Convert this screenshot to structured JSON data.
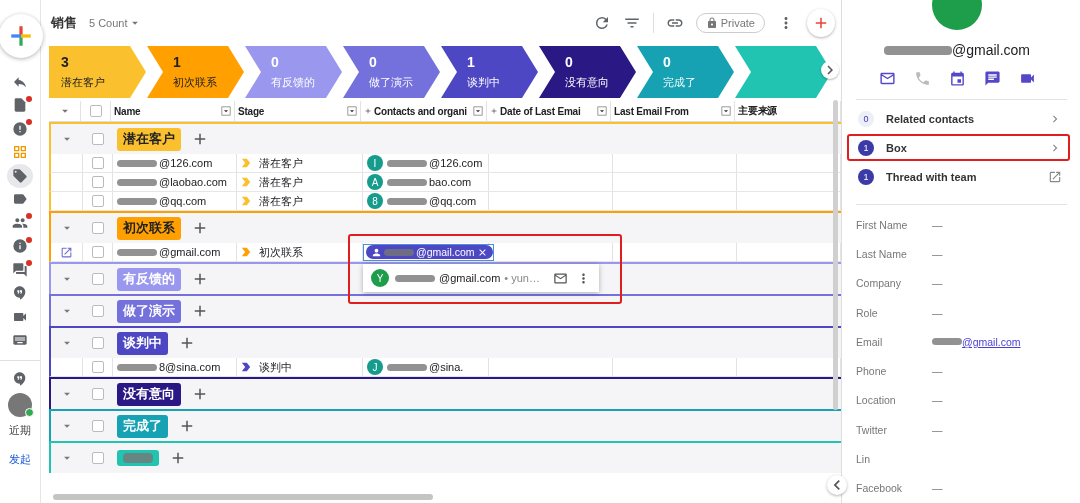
{
  "header": {
    "title": "销售",
    "count": "5 Count",
    "visibility": "Private"
  },
  "sidebar": {
    "items": [
      {
        "kind": "reply",
        "dot": false,
        "selected": false,
        "accent": false
      },
      {
        "kind": "doc",
        "dot": true,
        "selected": false,
        "accent": false
      },
      {
        "kind": "alert",
        "dot": true,
        "selected": false,
        "accent": false
      },
      {
        "kind": "grid",
        "dot": false,
        "selected": false,
        "accent": true
      },
      {
        "kind": "tag",
        "dot": false,
        "selected": true,
        "accent": false
      },
      {
        "kind": "label",
        "dot": false,
        "selected": false,
        "accent": false
      },
      {
        "kind": "people",
        "dot": true,
        "selected": false,
        "accent": false
      },
      {
        "kind": "info",
        "dot": true,
        "selected": false,
        "accent": false
      },
      {
        "kind": "forum",
        "dot": true,
        "selected": false,
        "accent": false
      },
      {
        "kind": "hangout",
        "dot": false,
        "selected": false,
        "accent": false
      },
      {
        "kind": "video",
        "dot": false,
        "selected": false,
        "accent": false
      },
      {
        "kind": "keyboard",
        "dot": false,
        "selected": false,
        "accent": false
      }
    ],
    "recent_label": "近期",
    "compose_link": "发起"
  },
  "stages": [
    {
      "count": "3",
      "label": "潜在客户",
      "color": "#fbc02d",
      "dark_text": true
    },
    {
      "count": "1",
      "label": "初次联系",
      "color": "#ffa000",
      "dark_text": true
    },
    {
      "count": "0",
      "label": "有反馈的",
      "color": "#9a98ee",
      "dark_text": false
    },
    {
      "count": "0",
      "label": "做了演示",
      "color": "#7471dc",
      "dark_text": false
    },
    {
      "count": "1",
      "label": "谈判中",
      "color": "#4e47c4",
      "dark_text": false
    },
    {
      "count": "0",
      "label": "没有意向",
      "color": "#2a1884",
      "dark_text": false
    },
    {
      "count": "0",
      "label": "完成了",
      "color": "#16a2b3",
      "dark_text": false
    }
  ],
  "table": {
    "all_checked": false,
    "columns": [
      "Name",
      "Stage",
      "Contacts and organi",
      "Date of Last Emai",
      "Last Email From",
      "主要来源"
    ],
    "groups": [
      {
        "label": "潜在客户",
        "color": "#fbc02d",
        "dark_text": true,
        "checked": false,
        "rows": [
          {
            "name": "@126.com",
            "stage": "潜在客户",
            "contact_initial": "I",
            "contact": "@126.com",
            "editing": false,
            "checked": false
          },
          {
            "name": "@laobao.com",
            "stage": "潜在客户",
            "contact_initial": "A",
            "contact": "bao.com",
            "editing": false,
            "checked": false
          },
          {
            "name": "@qq.com",
            "stage": "潜在客户",
            "contact_initial": "8",
            "contact": "@qq.com",
            "editing": false,
            "checked": false
          }
        ]
      },
      {
        "label": "初次联系",
        "color": "#ffa000",
        "dark_text": true,
        "checked": false,
        "rows": [
          {
            "name": "@gmail.com",
            "stage": "初次联系",
            "contact": "@gmail.com",
            "editing": true,
            "checked": false,
            "suggestion": {
              "initial": "Y",
              "email": "@gmail.com",
              "meta": "• yun…",
              "highlighted": true
            }
          }
        ]
      },
      {
        "label": "有反馈的",
        "color": "#9a98ee",
        "dark_text": false,
        "checked": false
      },
      {
        "label": "做了演示",
        "color": "#7471dc",
        "dark_text": false,
        "checked": false
      },
      {
        "label": "谈判中",
        "color": "#4e47c4",
        "dark_text": false,
        "checked": false,
        "rows": [
          {
            "name": "8@sina.com",
            "stage": "谈判中",
            "contact_initial": "J",
            "contact": "@sina.",
            "editing": false,
            "checked": false
          }
        ]
      },
      {
        "label": "没有意向",
        "color": "#2a1884",
        "dark_text": false,
        "checked": false
      },
      {
        "label": "完成了",
        "color": "#16a2b3",
        "dark_text": false,
        "checked": false
      },
      {
        "color": "#20c4b0",
        "checked": false
      }
    ]
  },
  "panel": {
    "email": "@gmail.com",
    "actions": [
      {
        "kind": "mail",
        "disabled": false
      },
      {
        "kind": "phone",
        "disabled": true
      },
      {
        "kind": "calendar",
        "disabled": false
      },
      {
        "kind": "chat",
        "disabled": false
      },
      {
        "kind": "video",
        "disabled": false
      }
    ],
    "links": [
      {
        "count": "0",
        "label": "Related contacts",
        "muted": true,
        "kind": "chevron",
        "highlighted": false
      },
      {
        "count": "1",
        "label": "Box",
        "muted": false,
        "kind": "chevron",
        "highlighted": true
      },
      {
        "count": "1",
        "label": "Thread with team",
        "muted": false,
        "kind": "external",
        "highlighted": false
      }
    ],
    "fields": [
      {
        "label": "First Name",
        "value": "—"
      },
      {
        "label": "Last Name",
        "value": "—"
      },
      {
        "label": "Company",
        "value": "—"
      },
      {
        "label": "Role",
        "value": "—"
      },
      {
        "label": "Email",
        "value": "@gmail.com",
        "kind": "link"
      },
      {
        "label": "Phone",
        "value": "—"
      },
      {
        "label": "Location",
        "value": "—"
      },
      {
        "label": "Twitter",
        "value": "—"
      },
      {
        "label": "Lin"
      },
      {
        "label": "Facebook",
        "value": "—"
      }
    ]
  }
}
